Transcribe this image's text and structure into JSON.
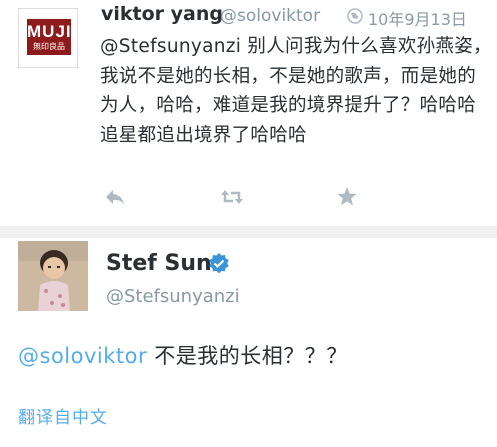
{
  "tweet1": {
    "avatar_logo": "MUJI",
    "avatar_logo_sub": "無印良品",
    "name": "viktor yang",
    "handle": "@soloviktor",
    "date": "10年9月13日",
    "text": "@Stefsunyanzi 别人问我为什么喜欢孙燕姿，我说不是她的长相，不是她的歌声，而是她的为人，哈哈，难道是我的境界提升了？哈哈哈 追星都追出境界了哈哈哈",
    "actions": [
      "reply-icon",
      "retweet-icon",
      "favorite-icon"
    ]
  },
  "tweet2": {
    "name": "Stef Sun",
    "handle": "@Stefsunyanzi",
    "mention": "@soloviktor",
    "text": " 不是我的长相？？？",
    "translate": "翻译自中文"
  },
  "colors": {
    "text": "#292f33",
    "secondary": "#8899a6",
    "link": "#55acee",
    "muji_red": "#8e1b1b",
    "verified": "#3b94d9"
  }
}
